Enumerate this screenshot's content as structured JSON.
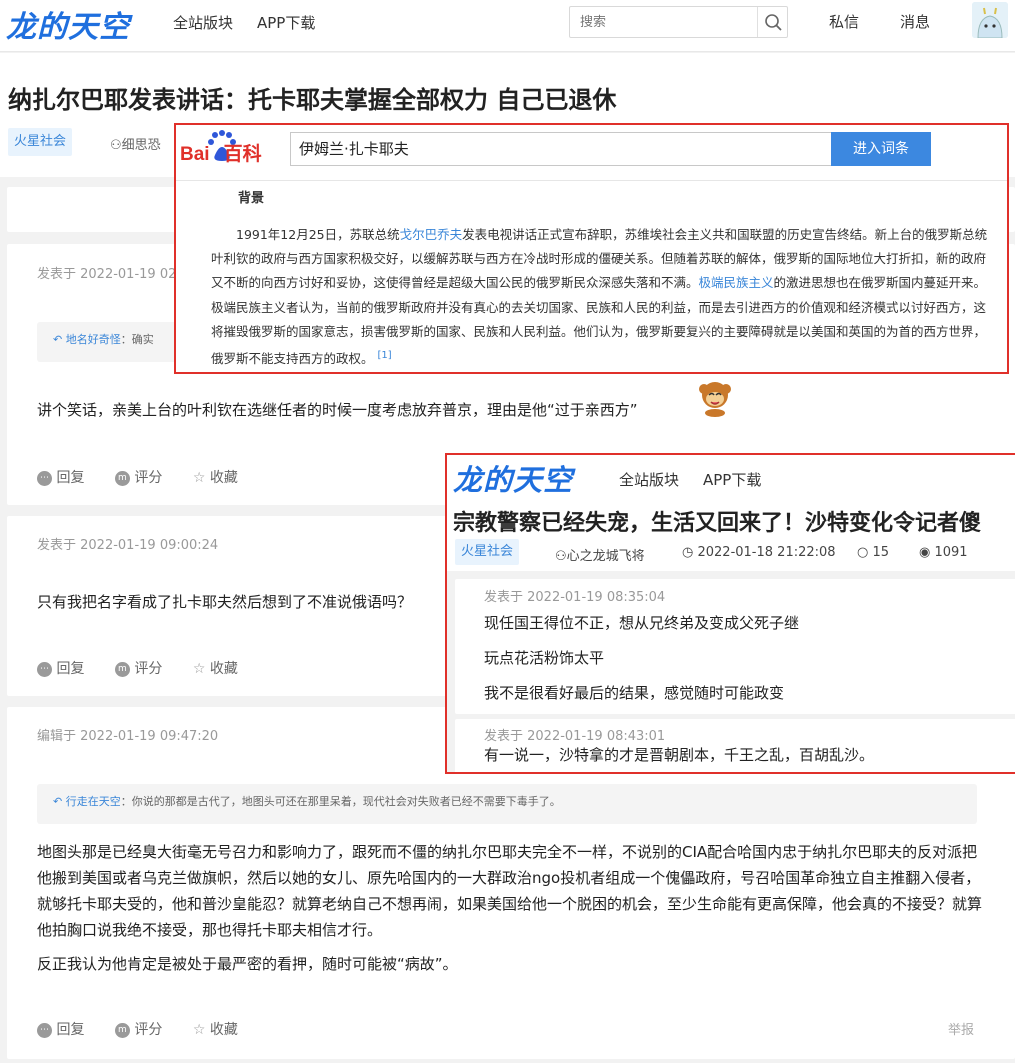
{
  "header": {
    "logo": "龙的天空",
    "nav": [
      "全站版块",
      "APP下载"
    ],
    "search_placeholder": "搜索",
    "messages": "私信",
    "notifications": "消息"
  },
  "thread": {
    "title": "纳扎尔巴耶发表讲话：托卡耶夫掌握全部权力 自己已退休",
    "tag": "火星社会",
    "author_partial": "细思恐"
  },
  "baike": {
    "brand_a": "Bai",
    "brand_b": "百科",
    "query": "伊姆兰·扎卡耶夫",
    "enter": "进入词条",
    "section": "背景",
    "p_a": "1991年12月25日，苏联总统",
    "link1": "戈尔巴乔夫",
    "p_b": "发表电视讲话正式宣布辞职，苏维埃社会主义共和国联盟的历史宣告终结。新上台的俄罗斯总统叶利钦的政府与西方国家积极交好，以缓解苏联与西方在冷战时形成的僵硬关系。但随着苏联的解体，俄罗斯的国际地位大打折扣，新的政府又不断的向西方讨好和妥协，这使得曾经是超级大国公民的俄罗斯民众深感失落和不满。",
    "link2": "极端民族主义",
    "p_c": "的激进思想也在俄罗斯国内蔓延开来。极端民族主义者认为，当前的俄罗斯政府并没有真心的去关切国家、民族和人民的利益，而是去引进西方的价值观和经济模式以讨好西方，这将摧毁俄罗斯的国家意志，损害俄罗斯的国家、民族和人民利益。他们认为，俄罗斯要复兴的主要障碍就是以美国和英国的为首的西方世界，俄罗斯不能支持西方的政权。",
    "ref": "[1]"
  },
  "posts": [
    {
      "meta": "发表于 2022-01-19 02",
      "quote_user": "地名好奇怪",
      "quote_text": "：确实",
      "body": "讲个笑话，亲美上台的叶利钦在选继任者的时候一度考虑放弃普京，理由是他“过于亲西方”",
      "reply": "回复",
      "rate": "评分",
      "fav": "收藏"
    },
    {
      "meta": "发表于 2022-01-19 09:00:24",
      "body": "只有我把名字看成了扎卡耶夫然后想到了不准说俄语吗？",
      "reply": "回复",
      "rate": "评分",
      "fav": "收藏"
    },
    {
      "meta": "编辑于 2022-01-19 09:47:20",
      "quote_user": "行走在天空",
      "quote_text": "：你说的那都是古代了，地图头可还在那里呆着，现代社会对失败者已经不需要下毒手了。",
      "body1": "地图头那是已经臭大街毫无号召力和影响力了，跟死而不僵的纳扎尔巴耶夫完全不一样，不说别的CIA配合哈国内忠于纳扎尔巴耶夫的反对派把他搬到美国或者乌克兰做旗帜，然后以她的女儿、原先哈国内的一大群政治ngo投机者组成一个傀儡政府，号召哈国革命独立自主推翻入侵者，就够托卡耶夫受的，他和普沙皇能忍？就算老纳自己不想再闹，如果美国给他一个脱困的机会，至少生命能有更高保障，他会真的不接受？就算他拍胸口说我绝不接受，那也得托卡耶夫相信才行。",
      "body2": "反正我认为他肯定是被处于最严密的看押，随时可能被“病故”。",
      "reply": "回复",
      "rate": "评分",
      "fav": "收藏",
      "report": "举报"
    }
  ],
  "popup": {
    "logo": "龙的天空",
    "nav": [
      "全站版块",
      "APP下载"
    ],
    "title": "宗教警察已经失宠，生活又回来了！沙特变化令记者傻",
    "tag": "火星社会",
    "author": "心之龙城飞将",
    "time": "2022-01-18 21:22:08",
    "comments": "15",
    "views": "1091",
    "post1_meta": "发表于 2022-01-19 08:35:04",
    "post1_lines": [
      "现任国王得位不正，想从兄终弟及变成父死子继",
      "玩点花活粉饰太平",
      "我不是很看好最后的结果，感觉随时可能政变"
    ],
    "post2_meta": "发表于 2022-01-19 08:43:01",
    "post2_line": "有一说一，沙特拿的才是晋朝剧本，千王之乱，百胡乱沙。"
  },
  "colors": {
    "brand": "#1f6fde",
    "highlight": "#e0302a",
    "link": "#3a86d8"
  }
}
